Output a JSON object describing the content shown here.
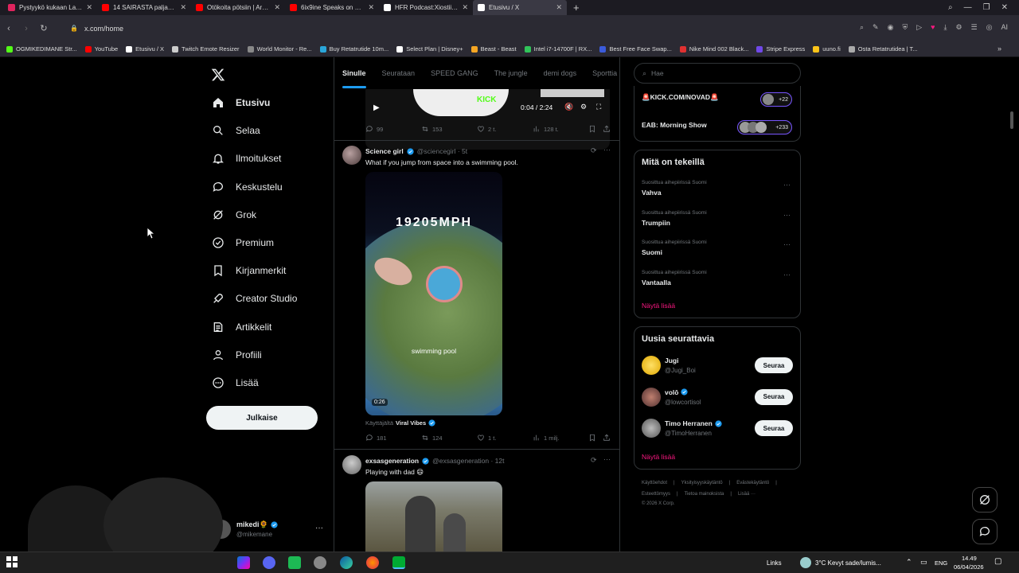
{
  "browser": {
    "tabs": [
      {
        "label": "Pystyykö kukaan Lahdess",
        "fav": "#e0245e",
        "active": false
      },
      {
        "label": "14 SAIRASTA paljastusta Y",
        "fav": "#ff0000",
        "active": false
      },
      {
        "label": "Otökoita pötsiin | Arvostel",
        "fav": "#ff0000",
        "active": false
      },
      {
        "label": "6ix9ine Speaks on Jail with",
        "fav": "#ff0000",
        "active": false
      },
      {
        "label": "HFR Podcast:Xiostii \"Pepe",
        "fav": "#ffffff",
        "active": false
      },
      {
        "label": "Etusivu / X",
        "fav": "#ffffff",
        "active": true
      }
    ],
    "new_tab": "+",
    "url": "x.com/home",
    "bookmarks": [
      {
        "label": "OGMIKEDIMANE Str...",
        "color": "#53fc18"
      },
      {
        "label": "YouTube",
        "color": "#ff0000"
      },
      {
        "label": "Etusivu / X",
        "color": "#ffffff"
      },
      {
        "label": "Twitch Emote Resizer",
        "color": "#cccccc"
      },
      {
        "label": "World Monitor - Re...",
        "color": "#888888"
      },
      {
        "label": "Buy Retatrutide 10m...",
        "color": "#2aa6d9"
      },
      {
        "label": "Select Plan | Disney+",
        "color": "#ffffff"
      },
      {
        "label": "Beast - Beast",
        "color": "#f5a623"
      },
      {
        "label": "Intel i7-14700F | RX...",
        "color": "#31c45a"
      },
      {
        "label": "Best Free Face Swap...",
        "color": "#3b5bdb"
      },
      {
        "label": "Nike Mind 002 Black...",
        "color": "#e03131"
      },
      {
        "label": "Stripe Express",
        "color": "#7048e8"
      },
      {
        "label": "uuno.fi",
        "color": "#fcc419"
      },
      {
        "label": "Osta Retatrutidea | T...",
        "color": "#aaaaaa"
      }
    ]
  },
  "sidebar": {
    "items": [
      {
        "label": "Etusivu",
        "icon": "home-icon"
      },
      {
        "label": "Selaa",
        "icon": "search-icon"
      },
      {
        "label": "Ilmoitukset",
        "icon": "bell-icon"
      },
      {
        "label": "Keskustelu",
        "icon": "chat-icon"
      },
      {
        "label": "Grok",
        "icon": "grok-icon"
      },
      {
        "label": "Premium",
        "icon": "premium-icon"
      },
      {
        "label": "Kirjanmerkit",
        "icon": "bookmark-icon"
      },
      {
        "label": "Creator Studio",
        "icon": "rocket-icon"
      },
      {
        "label": "Artikkelit",
        "icon": "article-icon"
      },
      {
        "label": "Profiili",
        "icon": "profile-icon"
      },
      {
        "label": "Lisää",
        "icon": "more-icon"
      }
    ],
    "post_label": "Julkaise",
    "account": {
      "name": "mikedi🌻",
      "handle": "@mikemane"
    }
  },
  "feed": {
    "tabs": [
      "Sinulle",
      "Seurataan",
      "SPEED GANG",
      "The jungle",
      "demi dogs",
      "Sporttia S"
    ],
    "top_video": {
      "time": "0:04 / 2:24",
      "overlay": "KICK",
      "replies": "99",
      "reposts": "153",
      "likes": "2 t.",
      "views": "128 t."
    },
    "tweet1": {
      "name": "Science girl",
      "handle": "@sciencegirl · 5t",
      "text": "What if you jump from space into a swimming pool.",
      "video_caption": "19205MPH",
      "video_label": "swimming pool",
      "duration": "0:26",
      "via_prefix": "Käyttäjältä",
      "via_name": "Viral Vibes",
      "replies": "181",
      "reposts": "124",
      "likes": "1 t.",
      "views": "1 milj."
    },
    "tweet2": {
      "name": "exsasgeneration",
      "handle": "@exsasgeneration · 12t",
      "text": "Playing with dad 😄"
    }
  },
  "right": {
    "search_placeholder": "Hae",
    "live": [
      {
        "label": "🚨KICK.COM/NOVAD🚨",
        "count": "+22"
      },
      {
        "label": "EAB: Morning Show",
        "count": "+233"
      }
    ],
    "trends_title": "Mitä on tekeillä",
    "trends": [
      {
        "meta": "Suosittua aihepiirissä Suomi",
        "name": "Vahva"
      },
      {
        "meta": "Suosittua aihepiirissä Suomi",
        "name": "Trumpiin"
      },
      {
        "meta": "Suosittua aihepiirissä Suomi",
        "name": "Suomi"
      },
      {
        "meta": "Suosittua aihepiirissä Suomi",
        "name": "Vantaalla"
      }
    ],
    "show_more": "Näytä lisää",
    "follow_title": "Uusia seurattavia",
    "follow": [
      {
        "name": "Jugi",
        "handle": "@Jugi_Boi",
        "verified": false,
        "btn": "Seuraa"
      },
      {
        "name": "volō",
        "handle": "@lowcortisol",
        "verified": true,
        "btn": "Seuraa"
      },
      {
        "name": "Timo Herranen",
        "handle": "@TimoHerranen",
        "verified": true,
        "btn": "Seuraa"
      }
    ],
    "show_more2": "Näytä lisää",
    "footer": [
      "Käyttöehdot",
      "Yksityisyyskäytäntö",
      "Evästekäytäntö",
      "Esteettömyys",
      "Tietoa mainoksista",
      "Lisää ···",
      "© 2026 X Corp."
    ]
  },
  "taskbar": {
    "links_label": "Links",
    "weather": "3°C  Kevyt sade/lumis...",
    "lang": "ENG",
    "time": "14.49",
    "date": "06/04/2026"
  }
}
